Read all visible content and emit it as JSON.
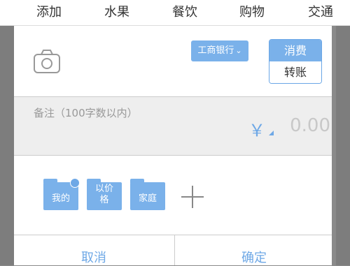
{
  "categories": [
    "添加",
    "水果",
    "餐饮",
    "购物",
    "交通"
  ],
  "bank_label": "工商银行",
  "type_toggle": {
    "selected": "消费",
    "other": "转账"
  },
  "notes_placeholder": "备注（100字数以内）",
  "currency_symbol": "￥",
  "amount": "0.00",
  "tags": [
    {
      "line1": "我的",
      "line2": ""
    },
    {
      "line1": "以价",
      "line2": "格"
    },
    {
      "line1": "家庭",
      "line2": ""
    }
  ],
  "cancel_label": "取消",
  "confirm_label": "确定",
  "colors": {
    "accent": "#7ab1ea",
    "text_accent": "#6ea8e6"
  },
  "icons": [
    "camera-icon",
    "chevron-down-icon",
    "check-badge-icon",
    "plus-icon"
  ]
}
